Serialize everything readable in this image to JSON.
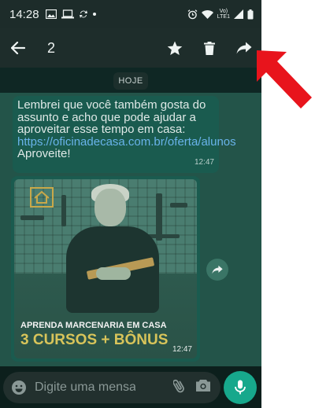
{
  "status_bar": {
    "time": "14:28",
    "carrier_badge_line1": "Vo)",
    "carrier_badge_line2": "LTE1"
  },
  "action_bar": {
    "selected_count": "2",
    "icons": [
      "back-arrow-icon",
      "star-icon",
      "trash-icon",
      "forward-icon"
    ]
  },
  "chat": {
    "date_label": "HOJE",
    "messages": [
      {
        "text_before_link": "Lembrei que você também gosta do assunto e acho que pode ajudar a aproveitar esse tempo em casa:",
        "link": "https://oficinadecasa.com.br/oferta/alunos",
        "text_after_link": " Aproveite!",
        "time": "12:47"
      },
      {
        "caption_small": "APRENDA MARCENARIA EM CASA",
        "caption_big": "3 CURSOS + BÔNUS",
        "time": "12:47"
      }
    ]
  },
  "composer": {
    "placeholder": "Digite uma mensa…"
  },
  "colors": {
    "accent": "#17a88c",
    "link": "#69b3ea",
    "annotation_arrow": "#e8141c"
  }
}
